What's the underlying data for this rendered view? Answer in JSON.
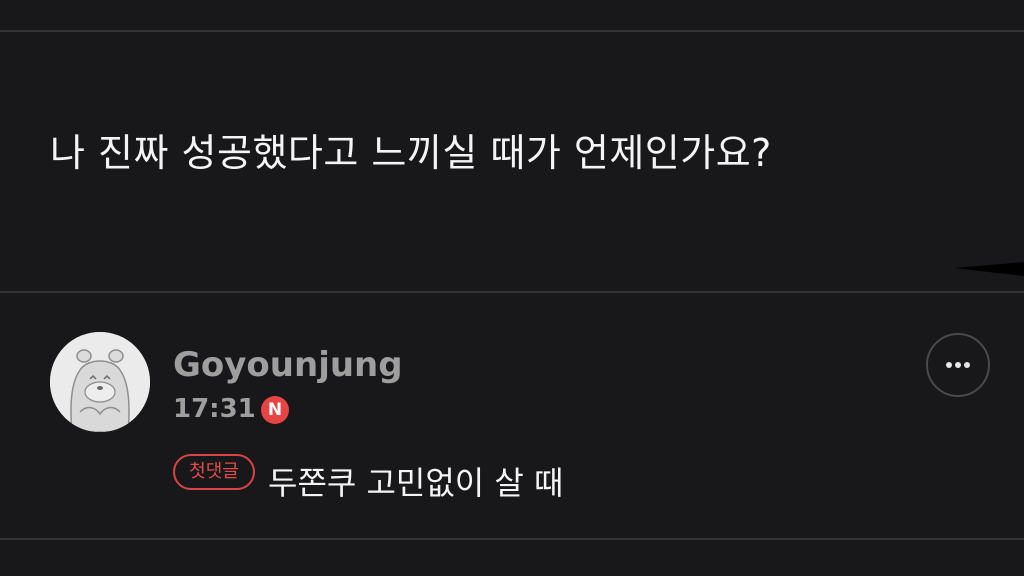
{
  "post": {
    "question": "나 진짜 성공했다고 느끼실 때가 언제인가요?"
  },
  "comment": {
    "author": "Goyounjung",
    "time": "17:31",
    "new_badge": "N",
    "first_comment_tag": "첫댓글",
    "text": "두쫀쿠 고민없이 살 때",
    "avatar_icon": "bear-avatar-icon",
    "more_icon": "more-options-icon"
  },
  "colors": {
    "background": "#18181b",
    "divider": "#343437",
    "muted_text": "#9e9e9e",
    "accent_red": "#e64545"
  }
}
